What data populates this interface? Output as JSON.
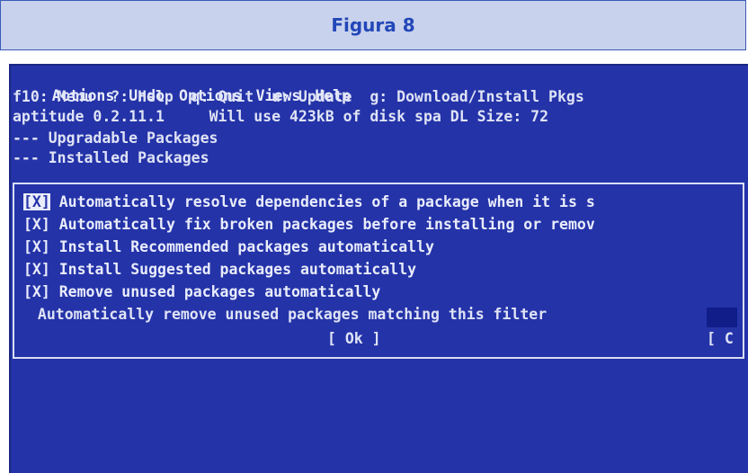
{
  "caption": "Figura 8",
  "menu": [
    "Actions",
    "Undo",
    "Options",
    "Views",
    "Help"
  ],
  "keys_line": "f10: Menu  ?: Help  q: Quit  u: Update  g: Download/Install Pkgs",
  "status": {
    "version": "aptitude 0.2.11.1",
    "info": "Will use 423kB of disk spa DL Size: 72"
  },
  "package_groups": [
    "--- Upgradable Packages",
    "--- Installed Packages"
  ],
  "dialog": {
    "options": [
      {
        "check": "[X]",
        "label": " Automatically resolve dependencies of a package when it is s"
      },
      {
        "check": "[X]",
        "label": " Automatically fix broken packages before installing or remov"
      },
      {
        "check": "[X]",
        "label": " Install Recommended packages automatically"
      },
      {
        "check": "[X]",
        "label": " Install Suggested packages automatically"
      },
      {
        "check": "[X]",
        "label": " Remove unused packages automatically"
      }
    ],
    "filter_label": " Automatically remove unused packages matching this filter",
    "ok_button": "[ Ok ]",
    "cancel_button": "[ C"
  },
  "colors": {
    "terminal_bg": "#2433a8",
    "text": "#dfe3f5",
    "caption_bg": "#c8d2ec",
    "caption_text": "#2247b8"
  }
}
